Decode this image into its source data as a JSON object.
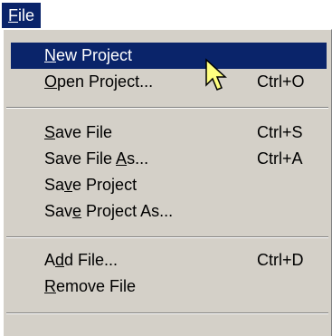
{
  "menubar": {
    "file": {
      "mnemonic": "F",
      "rest": "ile"
    }
  },
  "menu": {
    "new_project": {
      "pre": "",
      "mn": "N",
      "post": "ew Project",
      "shortcut": ""
    },
    "open_project": {
      "pre": "",
      "mn": "O",
      "post": "pen Project...",
      "shortcut": "Ctrl+O"
    },
    "save_file": {
      "pre": "",
      "mn": "S",
      "post": "ave File",
      "shortcut": "Ctrl+S"
    },
    "save_file_as": {
      "pre": "Save File ",
      "mn": "A",
      "post": "s...",
      "shortcut": "Ctrl+A"
    },
    "save_project": {
      "pre": "Sa",
      "mn": "v",
      "post": "e Project",
      "shortcut": ""
    },
    "save_project_as": {
      "pre": "Sav",
      "mn": "e",
      "post": " Project As...",
      "shortcut": ""
    },
    "add_file": {
      "pre": "A",
      "mn": "d",
      "post": "d File...",
      "shortcut": "Ctrl+D"
    },
    "remove_file": {
      "pre": "",
      "mn": "R",
      "post": "emove File",
      "shortcut": ""
    }
  },
  "highlighted_item": "new_project",
  "colors": {
    "highlight": "#0a246a",
    "menu_face": "#d4d0c8",
    "cursor_fill": "#ffff80"
  }
}
